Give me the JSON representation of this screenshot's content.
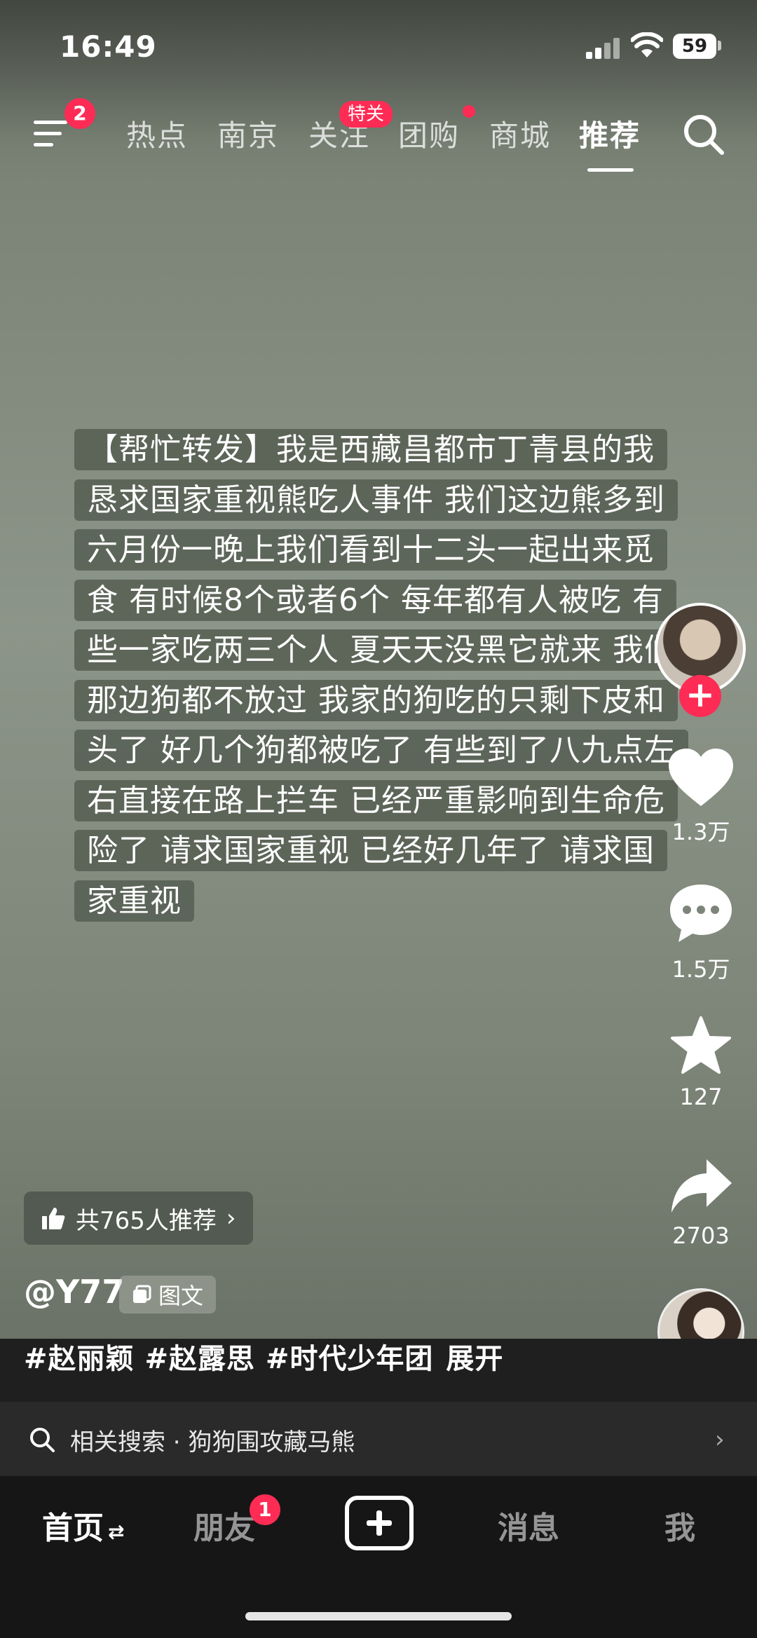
{
  "status_bar": {
    "time": "16:49",
    "battery": "59"
  },
  "top_nav": {
    "menu_badge": "2",
    "tabs": [
      "热点",
      "南京",
      "关注",
      "团购",
      "商城",
      "推荐"
    ],
    "follow_tag": "特关",
    "active_tab": "推荐"
  },
  "post": {
    "text": "【帮忙转发】我是西藏昌都市丁青县的我恳求国家重视熊吃人事件 我们这边熊多到六月份一晚上我们看到十二头一起出来觅食 有时候8个或者6个 每年都有人被吃 有些一家吃两三个人 夏天天没黑它就来 我们那边狗都不放过 我家的狗吃的只剩下皮和头了 好几个狗都被吃了 有些到了八九点左右直接在路上拦车 已经严重影响到生命危险了 请求国家重视 已经好几年了 请求国家重视"
  },
  "actions": {
    "likes": "1.3万",
    "comments": "1.5万",
    "favorites": "127",
    "shares": "2703"
  },
  "info": {
    "recommend": "共765人推荐",
    "author": "@Y77",
    "type_tag": "图文",
    "hashtags": "#赵丽颖 #赵露思 #时代少年团",
    "expand": "展开"
  },
  "related_search": {
    "text": "相关搜索 · 狗狗围攻藏马熊"
  },
  "tabbar": {
    "home": "首页",
    "friends": "朋友",
    "friends_badge": "1",
    "messages": "消息",
    "me": "我"
  }
}
